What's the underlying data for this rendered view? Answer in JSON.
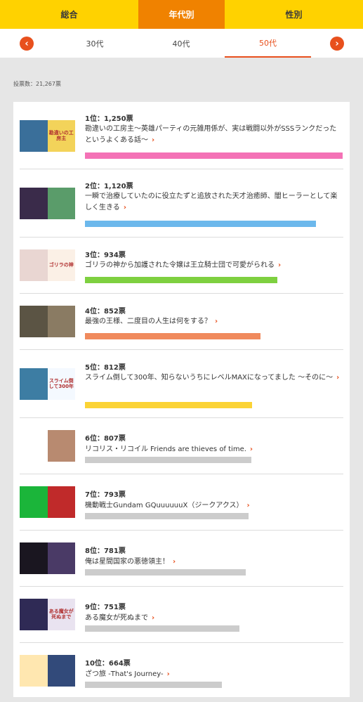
{
  "top_tabs": [
    "総合",
    "年代別",
    "性別"
  ],
  "sub_tabs": {
    "prev_icon": "chevron-left-icon",
    "next_icon": "chevron-right-icon",
    "items": [
      "30代",
      "40代",
      "50代"
    ]
  },
  "vote_total": "投票数：21,267票",
  "colors": {
    "accent": "#e8501d",
    "header_yellow": "#ffd200",
    "header_orange": "#f08200",
    "bar_gray": "#cccccc"
  },
  "ranking": [
    {
      "rank": "1位：1,250票",
      "title": "勘違いの工房主～英雄パーティの元雑用係が、実は戦闘以外がSSSランクだったというよくある話～",
      "votes": 1250,
      "bar_color": "#f472b6",
      "thumb_left": "#3a6f9a",
      "thumb_right": "#f3d35a",
      "thumb_right_text": "勘違いの工房主"
    },
    {
      "rank": "2位：1,120票",
      "title": "一瞬で治療していたのに役立たずと追放された天才治癒師、闇ヒーラーとして楽しく生きる",
      "votes": 1120,
      "bar_color": "#6cb8ec",
      "thumb_left": "#3a2b4a",
      "thumb_right": "#5a9c6a",
      "thumb_right_text": ""
    },
    {
      "rank": "3位：934票",
      "title": "ゴリラの神から加護された令嬢は王立騎士団で可愛がられる",
      "votes": 934,
      "bar_color": "#7ed040",
      "thumb_left": "#e9d6d2",
      "thumb_right": "#fbf0e6",
      "thumb_right_text": "ゴリラの神"
    },
    {
      "rank": "4位：852票",
      "title": "最強の王様、二度目の人生は何をする？",
      "votes": 852,
      "bar_color": "#f08a5d",
      "thumb_left": "#5b5444",
      "thumb_right": "#8a7b63",
      "thumb_right_text": ""
    },
    {
      "rank": "5位：812票",
      "title": "スライム倒して300年、知らないうちにレベルMAXになってました ～そのに～",
      "votes": 812,
      "bar_color": "#fbd335",
      "thumb_left": "#3d7da3",
      "thumb_right": "#f4f9ff",
      "thumb_right_text": "スライム倒して300年"
    },
    {
      "rank": "6位：807票",
      "title": "リコリス・リコイル Friends are thieves of time.",
      "votes": 807,
      "bar_color": "#cccccc",
      "thumb_left": "#ffffff",
      "thumb_right": "#b88a70",
      "thumb_right_text": ""
    },
    {
      "rank": "7位：793票",
      "title": "機動戦士Gundam GQuuuuuuX（ジークアクス）",
      "votes": 793,
      "bar_color": "#cccccc",
      "thumb_left": "#1bb53a",
      "thumb_right": "#c02a2a",
      "thumb_right_text": ""
    },
    {
      "rank": "8位：781票",
      "title": "俺は星間国家の悪徳領主！",
      "votes": 781,
      "bar_color": "#cccccc",
      "thumb_left": "#1a1620",
      "thumb_right": "#4a3a66",
      "thumb_right_text": ""
    },
    {
      "rank": "9位：751票",
      "title": "ある魔女が死ぬまで",
      "votes": 751,
      "bar_color": "#cccccc",
      "thumb_left": "#2f2a55",
      "thumb_right": "#e9e3f0",
      "thumb_right_text": "ある魔女が死ぬまで"
    },
    {
      "rank": "10位：664票",
      "title": "ざつ旅 -That's Journey-",
      "votes": 664,
      "bar_color": "#cccccc",
      "thumb_left": "#ffe7b0",
      "thumb_right": "#324a7a",
      "thumb_right_text": ""
    }
  ]
}
